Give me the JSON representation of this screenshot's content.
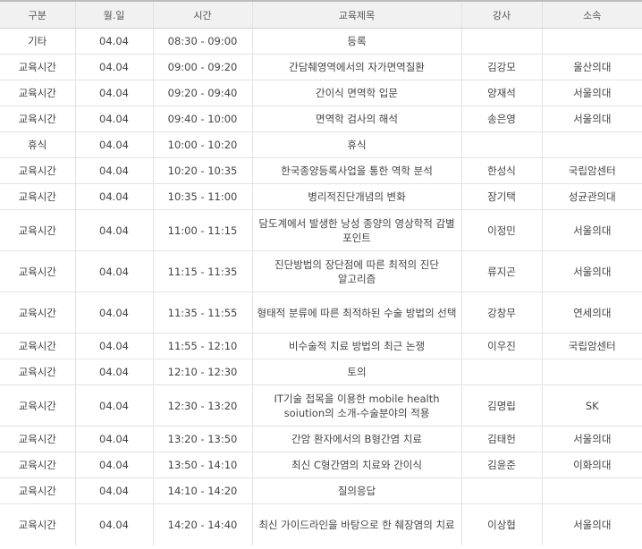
{
  "table": {
    "headers": {
      "type": "구분",
      "date": "월.일",
      "time": "시간",
      "title": "교육제목",
      "lecturer": "강사",
      "affiliation": "소속"
    },
    "rows": [
      {
        "type": "기타",
        "date": "04.04",
        "time": "08:30 - 09:00",
        "title": "등록",
        "lecturer": "",
        "affiliation": ""
      },
      {
        "type": "교육시간",
        "date": "04.04",
        "time": "09:00 - 09:20",
        "title": "간담췌영역에서의 자가면역질환",
        "lecturer": "김강모",
        "affiliation": "울산의대"
      },
      {
        "type": "교육시간",
        "date": "04.04",
        "time": "09:20 - 09:40",
        "title": "간이식 면역학 입문",
        "lecturer": "양재석",
        "affiliation": "서울의대"
      },
      {
        "type": "교육시간",
        "date": "04.04",
        "time": "09:40 - 10:00",
        "title": "면역학 검사의 해석",
        "lecturer": "송은영",
        "affiliation": "서울의대"
      },
      {
        "type": "휴식",
        "date": "04.04",
        "time": "10:00 - 10:20",
        "title": "휴식",
        "lecturer": "",
        "affiliation": ""
      },
      {
        "type": "교육시간",
        "date": "04.04",
        "time": "10:20 - 10:35",
        "title": "한국종양등록사업을 통한 역학 분석",
        "lecturer": "한성식",
        "affiliation": "국립암센터"
      },
      {
        "type": "교육시간",
        "date": "04.04",
        "time": "10:35 - 11:00",
        "title": "병리적진단개념의 변화",
        "lecturer": "장기택",
        "affiliation": "성균관의대"
      },
      {
        "type": "교육시간",
        "date": "04.04",
        "time": "11:00 - 11:15",
        "title": "담도계에서 발생한 낭성 종양의 영상학적 감별 포인트",
        "lecturer": "이정민",
        "affiliation": "서울의대"
      },
      {
        "type": "교육시간",
        "date": "04.04",
        "time": "11:15 - 11:35",
        "title": "진단방법의 장단점에 따른 최적의 진단 알고리즘",
        "lecturer": "류지곤",
        "affiliation": "서울의대"
      },
      {
        "type": "교육시간",
        "date": "04.04",
        "time": "11:35 - 11:55",
        "title": "형태적 분류에 따른 최적하된 수술 방법의 선택",
        "lecturer": "강창무",
        "affiliation": "연세의대"
      },
      {
        "type": "교육시간",
        "date": "04.04",
        "time": "11:55 - 12:10",
        "title": "비수술적 치료 방법의 최근 논쟁",
        "lecturer": "이우진",
        "affiliation": "국립암센터"
      },
      {
        "type": "교육시간",
        "date": "04.04",
        "time": "12:10 - 12:30",
        "title": "토의",
        "lecturer": "",
        "affiliation": ""
      },
      {
        "type": "교육시간",
        "date": "04.04",
        "time": "12:30 - 13:20",
        "title": "IT기술 접목을 이용한 mobile health soiution의 소개-수술분야의 적용",
        "lecturer": "김명립",
        "affiliation": "SK"
      },
      {
        "type": "교육시간",
        "date": "04.04",
        "time": "13:20 - 13:50",
        "title": "간암 환자에서의 B형간염 치료",
        "lecturer": "김태헌",
        "affiliation": "서울의대"
      },
      {
        "type": "교육시간",
        "date": "04.04",
        "time": "13:50 - 14:10",
        "title": "최신 C형간염의 치료와 간이식",
        "lecturer": "김윤준",
        "affiliation": "이화의대"
      },
      {
        "type": "교육시간",
        "date": "04.04",
        "time": "14:10 - 14:20",
        "title": "질의응답",
        "lecturer": "",
        "affiliation": ""
      },
      {
        "type": "교육시간",
        "date": "04.04",
        "time": "14:20 - 14:40",
        "title": "최신 가이드라인을 바탕으로 한 췌장염의 치료",
        "lecturer": "이상협",
        "affiliation": "서울의대"
      }
    ]
  }
}
